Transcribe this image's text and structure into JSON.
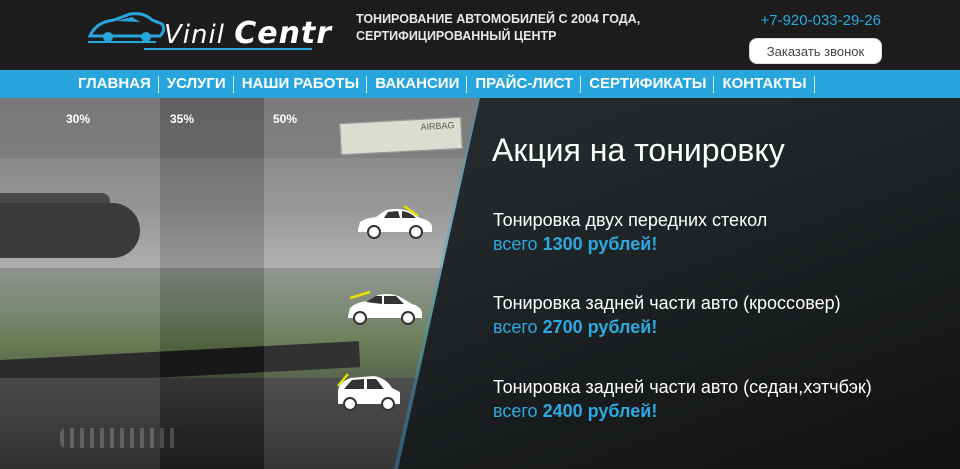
{
  "header": {
    "logo_text_a": "Vinil",
    "logo_text_b": "Centr",
    "tagline_line1": "Тонирование автомобилей с 2004 года,",
    "tagline_line2": "сертифицированный центр",
    "phone": "+7-920-033-29-26",
    "callback_label": "Заказать звонок"
  },
  "nav": {
    "items": [
      "Главная",
      "Услуги",
      "Наши работы",
      "Вакансии",
      "Прайс-лист",
      "Сертификаты",
      "Контакты"
    ]
  },
  "hero": {
    "tint_labels": [
      "30%",
      "35%",
      "50%"
    ],
    "sticker_text": "AIRBAG",
    "promo_title": "Акция на тонировку",
    "offers": [
      {
        "name": "Тонировка двух передних стекол",
        "price_prefix": "всего",
        "price": "1300 рублей!"
      },
      {
        "name": "Тонировка задней части авто (кроссовер)",
        "price_prefix": "всего",
        "price": "2700 рублей!"
      },
      {
        "name": "Тонировка задней части авто (седан,хэтчбэк)",
        "price_prefix": "всего",
        "price": "2400 рублей!"
      }
    ]
  },
  "colors": {
    "accent": "#27a6de",
    "header_bg": "#1c1c1c",
    "panel_bg": "#1f2426"
  },
  "icons": [
    "logo-car-icon",
    "sedan-front-windows-icon",
    "crossover-rear-icon",
    "hatchback-rear-icon"
  ]
}
